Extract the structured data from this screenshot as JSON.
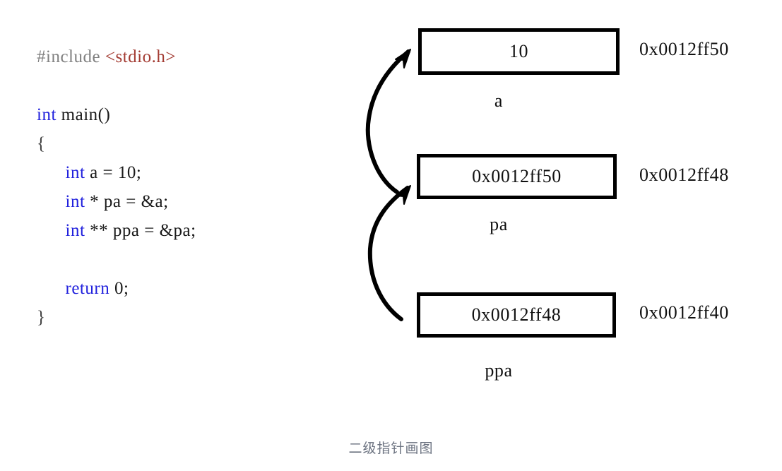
{
  "code": {
    "lines": [
      {
        "tokens": [
          {
            "text": "#include ",
            "type": "preproc"
          },
          {
            "text": "<stdio.h>",
            "type": "header"
          }
        ]
      },
      {
        "tokens": []
      },
      {
        "tokens": [
          {
            "text": "int",
            "type": "kw"
          },
          {
            "text": " main()",
            "type": "plain"
          }
        ]
      },
      {
        "tokens": [
          {
            "text": "{",
            "type": "brace"
          }
        ]
      },
      {
        "tokens": [
          {
            "text": "      ",
            "type": "plain"
          },
          {
            "text": "int",
            "type": "kw"
          },
          {
            "text": " a = 10;",
            "type": "plain"
          }
        ]
      },
      {
        "tokens": [
          {
            "text": "      ",
            "type": "plain"
          },
          {
            "text": "int",
            "type": "kw"
          },
          {
            "text": " * pa = &a;",
            "type": "plain"
          }
        ]
      },
      {
        "tokens": [
          {
            "text": "      ",
            "type": "plain"
          },
          {
            "text": "int",
            "type": "kw"
          },
          {
            "text": " ** ppa = &pa;",
            "type": "plain"
          }
        ]
      },
      {
        "tokens": []
      },
      {
        "tokens": [
          {
            "text": "      ",
            "type": "plain"
          },
          {
            "text": "return",
            "type": "kw"
          },
          {
            "text": " 0;",
            "type": "plain"
          }
        ]
      },
      {
        "tokens": [
          {
            "text": "}",
            "type": "brace"
          }
        ]
      }
    ]
  },
  "memory": {
    "cells": [
      {
        "id": "a",
        "value": "10",
        "var_name": "a",
        "address": "0x0012ff50"
      },
      {
        "id": "pa",
        "value": "0x0012ff50",
        "var_name": "pa",
        "address": "0x0012ff48"
      },
      {
        "id": "ppa",
        "value": "0x0012ff48",
        "var_name": "ppa",
        "address": "0x0012ff40"
      }
    ]
  },
  "arrows": [
    {
      "id": "ppa-to-pa",
      "from": "ppa",
      "to": "pa"
    },
    {
      "id": "pa-to-a",
      "from": "pa",
      "to": "a"
    }
  ],
  "caption": "二级指针画图",
  "colors": {
    "keyword": "#2222dd",
    "preprocessor": "#808080",
    "header_string": "#a33b32",
    "plain_text": "#1a1a1a",
    "box_border": "#000000",
    "caption": "#6b7280",
    "background": "#ffffff"
  }
}
